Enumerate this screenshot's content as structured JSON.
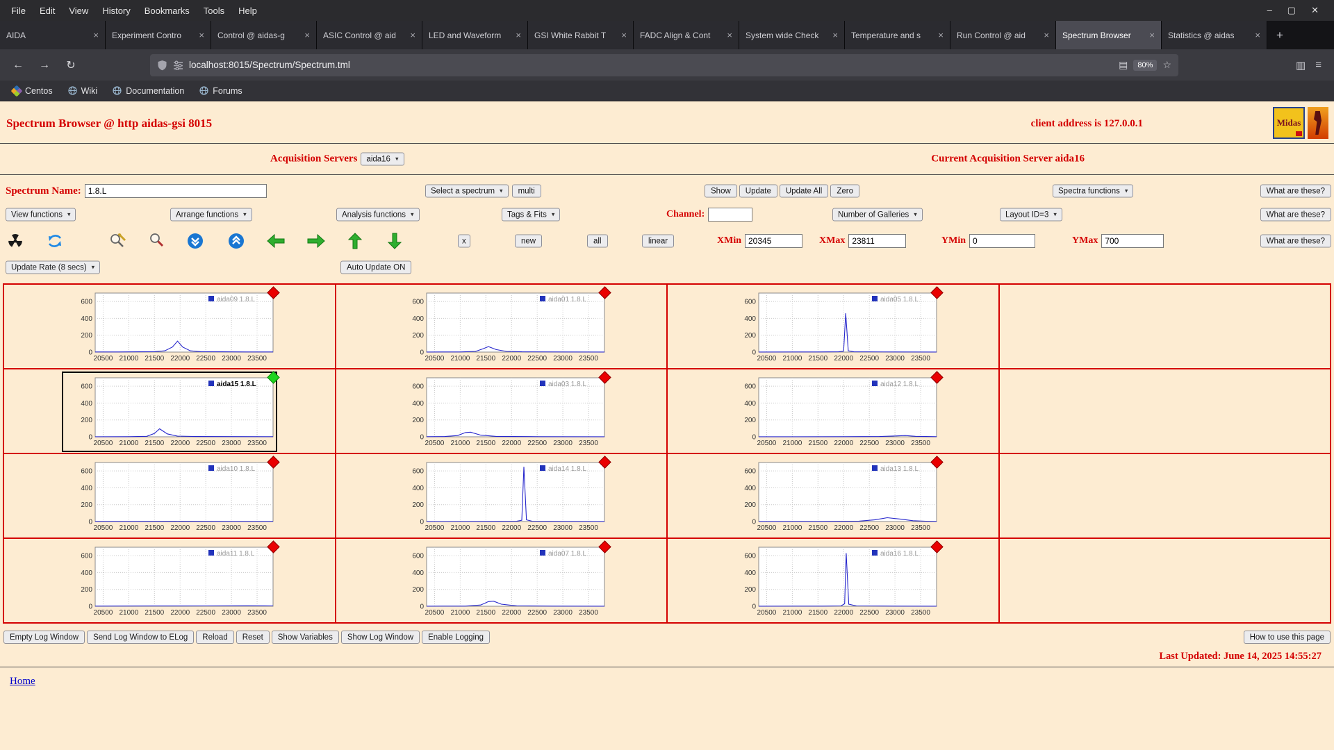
{
  "browser": {
    "menu": [
      "File",
      "Edit",
      "View",
      "History",
      "Bookmarks",
      "Tools",
      "Help"
    ],
    "window_controls": {
      "minimize": "–",
      "maximize": "▢",
      "close": "✕"
    },
    "tabs": [
      {
        "label": "AIDA",
        "active": false
      },
      {
        "label": "Experiment Contro",
        "active": false
      },
      {
        "label": "Control @ aidas-g",
        "active": false
      },
      {
        "label": "ASIC Control @ aid",
        "active": false
      },
      {
        "label": "LED and Waveform",
        "active": false
      },
      {
        "label": "GSI White Rabbit T",
        "active": false
      },
      {
        "label": "FADC Align & Cont",
        "active": false
      },
      {
        "label": "System wide Check",
        "active": false
      },
      {
        "label": "Temperature and s",
        "active": false
      },
      {
        "label": "Run Control @ aid",
        "active": false
      },
      {
        "label": "Spectrum Browser",
        "active": true
      },
      {
        "label": "Statistics @ aidas",
        "active": false
      }
    ],
    "url": "localhost:8015/Spectrum/Spectrum.tml",
    "zoom_badge": "80%",
    "bookmarks": [
      "Centos",
      "Wiki",
      "Documentation",
      "Forums"
    ]
  },
  "icons": {
    "back": "←",
    "forward": "→",
    "reload": "↻",
    "reader": "▤",
    "star": "☆",
    "sidebar": "▥",
    "menu": "≡",
    "new_tab": "+",
    "tab_close": "×",
    "caret": "▾"
  },
  "page": {
    "title": "Spectrum Browser @ http aidas-gsi 8015",
    "client_address": "client address is 127.0.0.1",
    "logo_text": "Midas",
    "acquisition_servers_label": "Acquisition Servers",
    "acquisition_server_selected": "aida16",
    "current_server_text": "Current Acquisition Server aida16",
    "spectrum_name_label": "Spectrum Name:",
    "spectrum_name_value": "1.8.L",
    "select_spectrum_label": "Select a spectrum",
    "multi_button": "multi",
    "show_button": "Show",
    "update_button": "Update",
    "update_all_button": "Update All",
    "zero_button": "Zero",
    "spectra_functions_label": "Spectra functions",
    "what_are_these_button": "What are these?",
    "view_functions_label": "View functions",
    "arrange_functions_label": "Arrange functions",
    "analysis_functions_label": "Analysis functions",
    "tags_fits_label": "Tags & Fits",
    "channel_label": "Channel:",
    "channel_value": "",
    "number_of_galleries_label": "Number of Galleries",
    "layout_id_label": "Layout ID=3",
    "x_button": "x",
    "new_button": "new",
    "all_button": "all",
    "linear_button": "linear",
    "xmin_label": "XMin",
    "xmin_value": "20345",
    "xmax_label": "XMax",
    "xmax_value": "23811",
    "ymin_label": "YMin",
    "ymin_value": "0",
    "ymax_label": "YMax",
    "ymax_value": "700",
    "update_rate_label": "Update Rate (8 secs)",
    "auto_update_button": "Auto Update ON",
    "footer_buttons": [
      "Empty Log Window",
      "Send Log Window to ELog",
      "Reload",
      "Reset",
      "Show Variables",
      "Show Log Window",
      "Enable Logging"
    ],
    "how_to_button": "How to use this page",
    "last_updated": "Last Updated: June 14, 2025 14:55:27",
    "home_link": "Home"
  },
  "chart_data": {
    "type": "line",
    "xlim": [
      20345,
      23811
    ],
    "ylim": [
      0,
      700
    ],
    "x_ticks": [
      20500,
      21000,
      21500,
      22000,
      22500,
      23000,
      23500
    ],
    "y_ticks": [
      0,
      200,
      400,
      600
    ],
    "grid": true,
    "line_color": "#2626cc",
    "layout": {
      "rows": 4,
      "cols": 4,
      "empty_last_col": true
    },
    "panels": [
      {
        "name": "aida09",
        "legend": "aida09 1.8.L",
        "marker": "red",
        "selected": false,
        "points": [
          [
            20345,
            2
          ],
          [
            20800,
            2
          ],
          [
            21200,
            3
          ],
          [
            21500,
            5
          ],
          [
            21700,
            15
          ],
          [
            21850,
            60
          ],
          [
            21950,
            130
          ],
          [
            22050,
            60
          ],
          [
            22200,
            15
          ],
          [
            22400,
            5
          ],
          [
            22800,
            3
          ],
          [
            23300,
            2
          ],
          [
            23811,
            2
          ]
        ]
      },
      {
        "name": "aida01",
        "legend": "aida01 1.8.L",
        "marker": "red",
        "selected": false,
        "points": [
          [
            20345,
            1
          ],
          [
            21000,
            2
          ],
          [
            21300,
            8
          ],
          [
            21450,
            40
          ],
          [
            21550,
            65
          ],
          [
            21700,
            30
          ],
          [
            21900,
            8
          ],
          [
            22200,
            3
          ],
          [
            23000,
            2
          ],
          [
            23811,
            1
          ]
        ]
      },
      {
        "name": "aida05",
        "legend": "aida05 1.8.L",
        "marker": "red",
        "selected": false,
        "points": [
          [
            20345,
            1
          ],
          [
            21500,
            2
          ],
          [
            21900,
            3
          ],
          [
            22000,
            10
          ],
          [
            22040,
            460
          ],
          [
            22090,
            15
          ],
          [
            22200,
            3
          ],
          [
            23000,
            2
          ],
          [
            23811,
            1
          ]
        ]
      },
      {
        "name": "aida15",
        "legend": "aida15 1.8.L",
        "marker": "green",
        "selected": true,
        "points": [
          [
            20345,
            1
          ],
          [
            21000,
            2
          ],
          [
            21350,
            6
          ],
          [
            21500,
            40
          ],
          [
            21600,
            95
          ],
          [
            21750,
            35
          ],
          [
            21950,
            8
          ],
          [
            22300,
            3
          ],
          [
            23811,
            2
          ]
        ]
      },
      {
        "name": "aida03",
        "legend": "aida03 1.8.L",
        "marker": "red",
        "selected": false,
        "points": [
          [
            20345,
            2
          ],
          [
            20700,
            3
          ],
          [
            20950,
            15
          ],
          [
            21100,
            50
          ],
          [
            21200,
            55
          ],
          [
            21400,
            20
          ],
          [
            21700,
            5
          ],
          [
            22500,
            2
          ],
          [
            23811,
            1
          ]
        ]
      },
      {
        "name": "aida12",
        "legend": "aida12 1.8.L",
        "marker": "red",
        "selected": false,
        "points": [
          [
            20345,
            1
          ],
          [
            21000,
            1
          ],
          [
            22000,
            2
          ],
          [
            22700,
            3
          ],
          [
            23000,
            10
          ],
          [
            23200,
            15
          ],
          [
            23400,
            6
          ],
          [
            23811,
            2
          ]
        ]
      },
      {
        "name": "aida10",
        "legend": "aida10 1.8.L",
        "marker": "red",
        "selected": false,
        "points": [
          [
            20345,
            2
          ],
          [
            21000,
            2
          ],
          [
            22000,
            3
          ],
          [
            23000,
            2
          ],
          [
            23811,
            2
          ]
        ]
      },
      {
        "name": "aida14",
        "legend": "aida14 1.8.L",
        "marker": "red",
        "selected": false,
        "points": [
          [
            20345,
            1
          ],
          [
            21500,
            2
          ],
          [
            22100,
            3
          ],
          [
            22200,
            15
          ],
          [
            22240,
            650
          ],
          [
            22290,
            20
          ],
          [
            22400,
            4
          ],
          [
            23000,
            2
          ],
          [
            23811,
            1
          ]
        ]
      },
      {
        "name": "aida13",
        "legend": "aida13 1.8.L",
        "marker": "red",
        "selected": false,
        "points": [
          [
            20345,
            1
          ],
          [
            21500,
            2
          ],
          [
            22300,
            5
          ],
          [
            22600,
            20
          ],
          [
            22850,
            45
          ],
          [
            23100,
            30
          ],
          [
            23350,
            10
          ],
          [
            23600,
            4
          ],
          [
            23811,
            2
          ]
        ]
      },
      {
        "name": "aida11",
        "legend": "aida11 1.8.L",
        "marker": "red",
        "selected": false,
        "points": [
          [
            20345,
            2
          ],
          [
            21500,
            3
          ],
          [
            22500,
            4
          ],
          [
            23300,
            6
          ],
          [
            23811,
            4
          ]
        ]
      },
      {
        "name": "aida07",
        "legend": "aida07 1.8.L",
        "marker": "red",
        "selected": false,
        "points": [
          [
            20345,
            1
          ],
          [
            21100,
            2
          ],
          [
            21400,
            15
          ],
          [
            21550,
            55
          ],
          [
            21650,
            60
          ],
          [
            21800,
            25
          ],
          [
            22100,
            5
          ],
          [
            22800,
            2
          ],
          [
            23811,
            1
          ]
        ]
      },
      {
        "name": "aida16",
        "legend": "aida16 1.8.L",
        "marker": "red",
        "selected": false,
        "points": [
          [
            20345,
            1
          ],
          [
            21600,
            2
          ],
          [
            21950,
            4
          ],
          [
            22020,
            30
          ],
          [
            22050,
            630
          ],
          [
            22100,
            25
          ],
          [
            22250,
            4
          ],
          [
            23000,
            2
          ],
          [
            23811,
            1
          ]
        ]
      }
    ]
  }
}
